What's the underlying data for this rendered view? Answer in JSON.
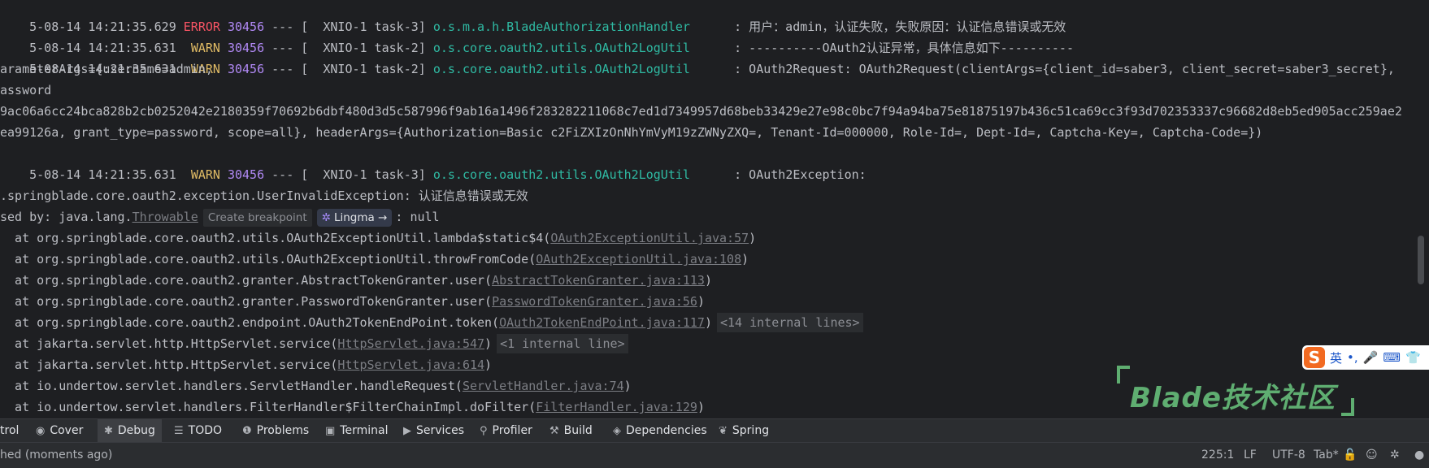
{
  "console": {
    "lines": [
      {
        "date": "5-08-14 14:21:35.629",
        "level": "ERROR",
        "pid": "30456",
        "sep": "---",
        "thread": "[  XNIO-1 task-3]",
        "logger": "o.s.m.a.h.BladeAuthorizationHandler",
        "message": ": 用户：admin，认证失败，失败原因：认证信息错误或无效"
      },
      {
        "date": "5-08-14 14:21:35.631",
        "level": "WARN",
        "pid": "30456",
        "sep": "---",
        "thread": "[  XNIO-1 task-2]",
        "logger": "o.s.core.oauth2.utils.OAuth2LogUtil",
        "message": ": ----------OAuth2认证异常，具体信息如下----------"
      },
      {
        "date": "5-08-14 14:21:35.631",
        "level": "WARN",
        "pid": "30456",
        "sep": "---",
        "thread": "[  XNIO-1 task-2]",
        "logger": "o.s.core.oauth2.utils.OAuth2LogUtil",
        "message": ": OAuth2Request: OAuth2Request(clientArgs={client_id=saber3, client_secret=saber3_secret},"
      }
    ],
    "cont1": "arameterArgs={username=admin,",
    "cont2": "assword",
    "cont3": "9ac06a6cc24bca828b2cb0252042e2180359f70692b6dbf480d3d5c587996f9ab16a1496f283282211068c7ed1d7349957d68beb33429e27e98c0bc7f94a94ba75e81875197b436c51ca69cc3f93d702353337c96682d8eb5ed905acc259ae2",
    "cont4": "ea99126a, grant_type=password, scope=all}, headerArgs={Authorization=Basic c2FiZXIzOnNhYmVyM19zZWNyZXQ=, Tenant-Id=000000, Role-Id=, Dept-Id=, Captcha-Key=, Captcha-Code=})",
    "line5": {
      "date": "5-08-14 14:21:35.631",
      "level": "WARN",
      "pid": "30456",
      "sep": "---",
      "thread": "[  XNIO-1 task-3]",
      "logger": "o.s.core.oauth2.utils.OAuth2LogUtil",
      "message": ": OAuth2Exception:"
    },
    "exception": ".springblade.core.oauth2.exception.UserInvalidException: 认证信息错误或无效",
    "caused_prefix": "sed by: java.lang.",
    "caused_link": "Throwable",
    "create_breakpoint": "Create breakpoint",
    "lingma_label": "Lingma →",
    "caused_suffix": ": null",
    "stack": [
      {
        "text": "  at org.springblade.core.oauth2.utils.OAuth2ExceptionUtil.lambda$static$4(",
        "link": "OAuth2ExceptionUtil.java:57",
        "close": ")",
        "chip": ""
      },
      {
        "text": "  at org.springblade.core.oauth2.utils.OAuth2ExceptionUtil.throwFromCode(",
        "link": "OAuth2ExceptionUtil.java:108",
        "close": ")",
        "chip": ""
      },
      {
        "text": "  at org.springblade.core.oauth2.granter.AbstractTokenGranter.user(",
        "link": "AbstractTokenGranter.java:113",
        "close": ")",
        "chip": ""
      },
      {
        "text": "  at org.springblade.core.oauth2.granter.PasswordTokenGranter.user(",
        "link": "PasswordTokenGranter.java:56",
        "close": ")",
        "chip": ""
      },
      {
        "text": "  at org.springblade.core.oauth2.endpoint.OAuth2TokenEndPoint.token(",
        "link": "OAuth2TokenEndPoint.java:117",
        "close": ")",
        "chip": "<14 internal lines>"
      },
      {
        "text": "  at jakarta.servlet.http.HttpServlet.service(",
        "link": "HttpServlet.java:547",
        "close": ")",
        "chip": "<1 internal line>"
      },
      {
        "text": "  at jakarta.servlet.http.HttpServlet.service(",
        "link": "HttpServlet.java:614",
        "close": ")",
        "chip": ""
      },
      {
        "text": "  at io.undertow.servlet.handlers.ServletHandler.handleRequest(",
        "link": "ServletHandler.java:74",
        "close": ")",
        "chip": ""
      },
      {
        "text": "  at io.undertow.servlet.handlers.FilterHandler$FilterChainImpl.doFilter(",
        "link": "FilterHandler.java:129",
        "close": ")",
        "chip": ""
      }
    ]
  },
  "ime": {
    "logo": "S",
    "lang": "英",
    "punct": "•,",
    "mic": "🎤",
    "keyboard": "⌨",
    "skin": "👕"
  },
  "watermark": "Blade技术社区",
  "toolbar": {
    "tabs": [
      {
        "label": "trol",
        "icon": ""
      },
      {
        "label": "Cover",
        "icon": "◉"
      },
      {
        "label": "Debug",
        "icon": "✱"
      },
      {
        "label": "TODO",
        "icon": "☰"
      },
      {
        "label": "Problems",
        "icon": "❶"
      },
      {
        "label": "Terminal",
        "icon": "▣"
      },
      {
        "label": "Services",
        "icon": "▶"
      },
      {
        "label": "Profiler",
        "icon": "⚲"
      },
      {
        "label": "Build",
        "icon": "⚒"
      },
      {
        "label": "Dependencies",
        "icon": "◈"
      },
      {
        "label": "Spring",
        "icon": "❦"
      }
    ]
  },
  "status": {
    "left": "hed (moments ago)",
    "position": "225:1",
    "line_sep": "LF",
    "encoding": "UTF-8",
    "indent": "Tab*"
  },
  "colors": {
    "error": "#f75464",
    "warn": "#e0bb65",
    "pid": "#b189f5",
    "logger": "#2fbaa3",
    "watermark": "#5fae71"
  }
}
